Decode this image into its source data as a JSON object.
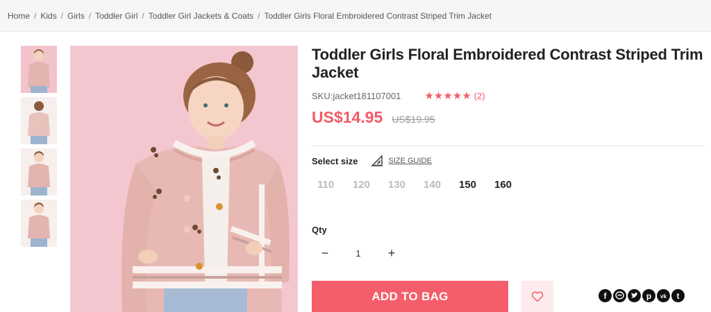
{
  "breadcrumb": {
    "items": [
      "Home",
      "Kids",
      "Girls",
      "Toddler Girl",
      "Toddler Girl Jackets & Coats",
      "Toddler Girls Floral Embroidered Contrast Striped Trim Jacket"
    ],
    "separator": "/"
  },
  "product": {
    "title": "Toddler Girls Floral Embroidered Contrast Striped Trim Jacket",
    "sku": "SKU:jacket181107001",
    "rating_stars": "★★★★★",
    "review_count": "(2)",
    "price": "US$14.95",
    "original_price": "US$19.95"
  },
  "size": {
    "label": "Select size",
    "guide_label": "SIZE GUIDE",
    "options": [
      {
        "value": "110",
        "available": false
      },
      {
        "value": "120",
        "available": false
      },
      {
        "value": "130",
        "available": false
      },
      {
        "value": "140",
        "available": false
      },
      {
        "value": "150",
        "available": true
      },
      {
        "value": "160",
        "available": true
      }
    ]
  },
  "quantity": {
    "label": "Qty",
    "value": "1",
    "decrement": "−",
    "increment": "+"
  },
  "actions": {
    "add_to_bag": "ADD TO BAG",
    "wishlist_icon": "heart-icon"
  },
  "share": {
    "icons": [
      "facebook-icon",
      "messenger-icon",
      "twitter-icon",
      "pinterest-icon",
      "vk-icon",
      "tumblr-icon"
    ]
  },
  "colors": {
    "accent": "#f45e6a",
    "price": "#f55a67",
    "star": "#f25d64",
    "image_bg": "#f4c6cf"
  }
}
